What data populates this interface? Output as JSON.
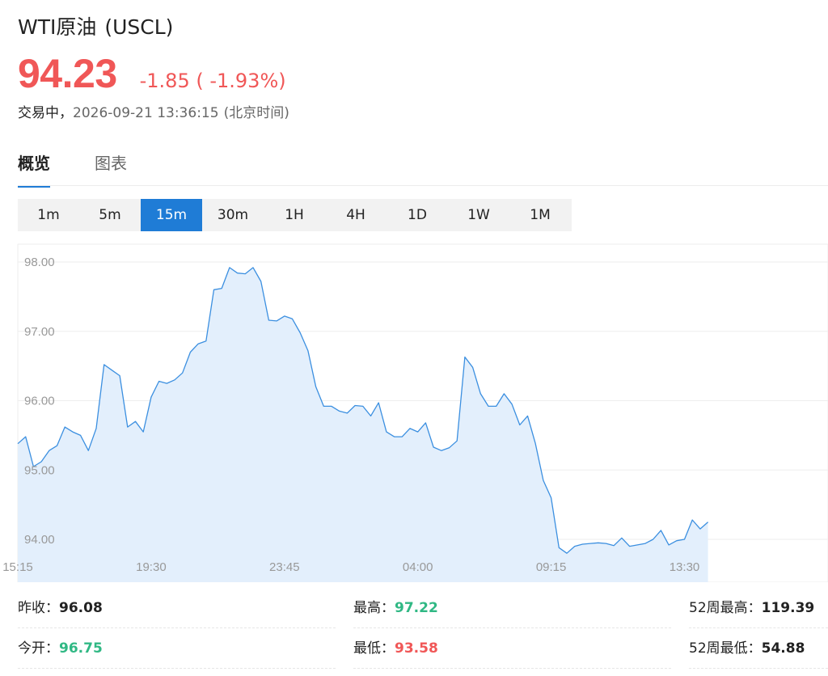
{
  "header": {
    "name": "WTI原油",
    "symbol": "(USCL)",
    "price": "94.23",
    "change": "-1.85 ( -1.93%)",
    "status": "交易中，",
    "timestamp": "2026-09-21 13:36:15",
    "timezone": "(北京时间)"
  },
  "colors": {
    "down": "#f05757",
    "up": "#30b884",
    "accent": "#1f7cd6",
    "line": "#3b8fe0",
    "fill": "#e3effc"
  },
  "tabs": [
    {
      "label": "概览"
    },
    {
      "label": "图表"
    }
  ],
  "intervals": [
    "1m",
    "5m",
    "15m",
    "30m",
    "1H",
    "4H",
    "1D",
    "1W",
    "1M"
  ],
  "selected_interval": "15m",
  "chart_data": {
    "type": "area",
    "ylim": [
      93.75,
      98.25
    ],
    "yticks": [
      98.0,
      97.0,
      96.0,
      95.0,
      94.0
    ],
    "ytick_labels": [
      "98.00",
      "97.00",
      "96.00",
      "95.00",
      "94.00"
    ],
    "xtick_labels": [
      "15:15",
      "19:30",
      "23:45",
      "04:00",
      "09:15",
      "13:30"
    ],
    "xtick_index": [
      0,
      17,
      34,
      51,
      68,
      85
    ],
    "grid": true,
    "values": [
      95.38,
      95.48,
      95.05,
      95.12,
      95.28,
      95.35,
      95.62,
      95.55,
      95.5,
      95.28,
      95.6,
      96.52,
      96.44,
      96.36,
      95.62,
      95.7,
      95.55,
      96.05,
      96.28,
      96.25,
      96.3,
      96.4,
      96.7,
      96.82,
      96.86,
      97.6,
      97.62,
      97.92,
      97.84,
      97.83,
      97.92,
      97.72,
      97.16,
      97.15,
      97.22,
      97.18,
      96.98,
      96.72,
      96.2,
      95.92,
      95.92,
      95.85,
      95.82,
      95.93,
      95.92,
      95.78,
      95.97,
      95.55,
      95.48,
      95.48,
      95.6,
      95.55,
      95.68,
      95.33,
      95.28,
      95.32,
      95.42,
      96.63,
      96.48,
      96.1,
      95.92,
      95.92,
      96.1,
      95.95,
      95.65,
      95.78,
      95.38,
      94.85,
      94.6,
      93.88,
      93.8,
      93.9,
      93.93,
      93.94,
      93.95,
      93.94,
      93.91,
      94.02,
      93.9,
      93.92,
      93.94,
      94.0,
      94.13,
      93.92,
      93.98,
      94.0,
      94.28,
      94.15,
      94.25
    ]
  },
  "stats": [
    {
      "label": "昨收：",
      "value": "96.08",
      "color": "#222222"
    },
    {
      "label": "最高：",
      "value": "97.22",
      "color": "#30b884"
    },
    {
      "label": "52周最高：",
      "value": "119.39",
      "color": "#222222"
    },
    {
      "label": "今开：",
      "value": "96.75",
      "color": "#30b884"
    },
    {
      "label": "最低：",
      "value": "93.58",
      "color": "#f05757"
    },
    {
      "label": "52周最低：",
      "value": "54.88",
      "color": "#222222"
    }
  ]
}
